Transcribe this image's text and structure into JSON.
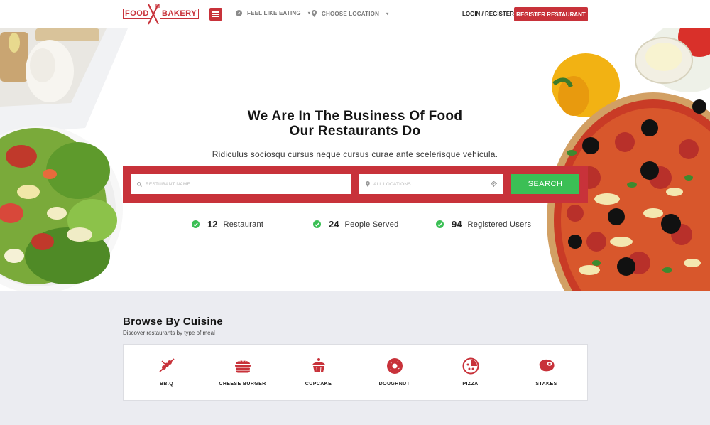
{
  "brand": {
    "logo_left": "FOOD",
    "logo_right": "BAKERY",
    "accent": "#c8323a",
    "green": "#3bbf55"
  },
  "header": {
    "menu_icon": "hamburger-icon",
    "feel_like_eating": "FEEL LIKE EATING",
    "choose_location": "CHOOSE LOCATION",
    "login": "LOGIN / REGISTER",
    "register_restaurant": "REGISTER RESTAURANT"
  },
  "hero": {
    "title_line1": "We Are In The Business Of Food",
    "title_line2": "Our Restaurants Do",
    "subtitle": "Ridiculus sociosqu cursus neque cursus curae ante scelerisque vehicula.",
    "search": {
      "name_placeholder": "RESTURANT NAME",
      "location_placeholder": "ALL LOCATIONS",
      "button": "SEARCH"
    },
    "stats": [
      {
        "value": "12",
        "label": "Restaurant"
      },
      {
        "value": "24",
        "label": "People Served"
      },
      {
        "value": "94",
        "label": "Registered Users"
      }
    ]
  },
  "browse": {
    "title": "Browse By Cuisine",
    "subtitle": "Discover restaurants by type of meal",
    "cuisines": [
      {
        "label": "BB.Q",
        "icon": "bbq-skewer-icon"
      },
      {
        "label": "CHEESE BURGER",
        "icon": "burger-icon"
      },
      {
        "label": "CUPCAKE",
        "icon": "cupcake-icon"
      },
      {
        "label": "DOUGHNUT",
        "icon": "doughnut-icon"
      },
      {
        "label": "PIZZA",
        "icon": "pizza-icon"
      },
      {
        "label": "STAKES",
        "icon": "steak-icon"
      }
    ]
  }
}
